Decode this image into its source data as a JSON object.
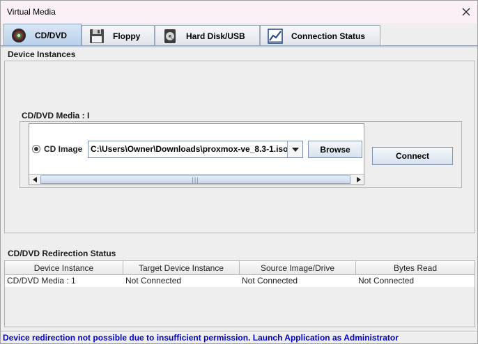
{
  "window": {
    "title": "Virtual Media"
  },
  "tabs": [
    {
      "label": "CD/DVD",
      "icon": "cd-dvd-icon",
      "active": true
    },
    {
      "label": "Floppy",
      "icon": "floppy-icon",
      "active": false
    },
    {
      "label": "Hard Disk/USB",
      "icon": "hard-disk-icon",
      "active": false
    },
    {
      "label": "Connection Status",
      "icon": "connection-status-icon",
      "active": false
    }
  ],
  "device_instances": {
    "section_title": "Device Instances",
    "group_title": "CD/DVD Media : I",
    "radio_label": "CD Image",
    "image_path": "C:\\Users\\Owner\\Downloads\\proxmox-ve_8.3-1.iso",
    "browse_label": "Browse",
    "connect_label": "Connect"
  },
  "redirection_status": {
    "section_title": "CD/DVD Redirection Status",
    "columns": [
      "Device Instance",
      "Target Device Instance",
      "Source Image/Drive",
      "Bytes Read"
    ],
    "rows": [
      [
        "CD/DVD Media :  1",
        "Not Connected",
        "Not Connected",
        "Not Connected"
      ]
    ]
  },
  "status": {
    "message": "Device redirection not possible due to insufficient permission. Launch Application as Administrator",
    "color": "#0000cc"
  }
}
